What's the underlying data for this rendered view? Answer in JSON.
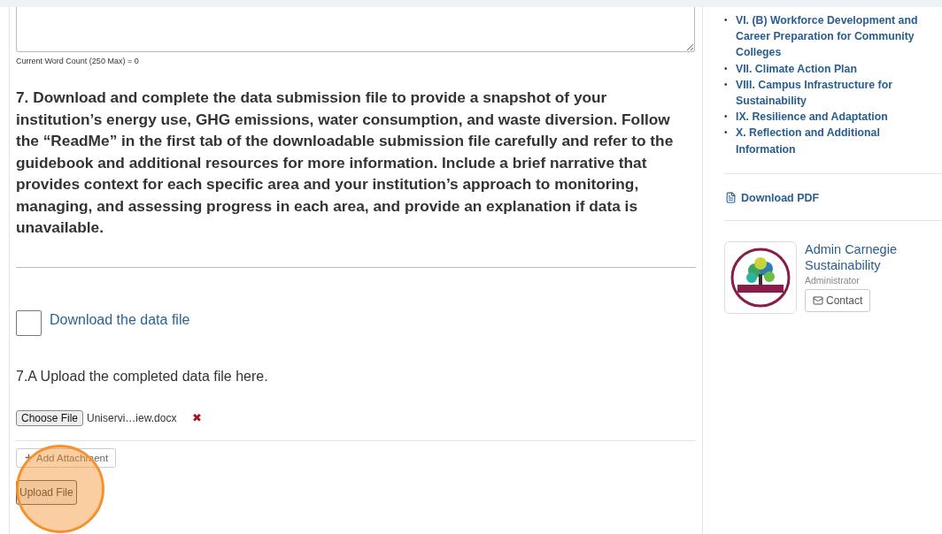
{
  "main": {
    "word_count": "Current Word Count (250 Max) = 0",
    "question": "7. Download and complete the data submission file to provide a snapshot of your institution’s energy use, GHG emissions, water consumption, and waste diversion. Follow the “ReadMe” in the first tab of the downloadable submission file carefully and refer to the guidebook and additional resources for more information. Include a brief narrative that provides context for each specific area and your institution’s approach to monitoring, managing, and assessing progress in each area, and provide an explanation if data is unavailable.",
    "download": {
      "label": "Download the data file",
      "checked": false
    },
    "upload_prompt": "7.A Upload the completed data file here.",
    "file_input": {
      "button": "Choose File",
      "filename": "Uniservi…iew.docx",
      "remove": "✖"
    },
    "add_attachment": "Add Attachment",
    "upload_button": "Upload File"
  },
  "sidebar": {
    "sections": [
      {
        "marker": "•",
        "label": "VI. (B) Workforce Development and Career Preparation for Community Colleges"
      },
      {
        "marker": "•",
        "label": "VII. Climate Action Plan"
      },
      {
        "marker": "•",
        "label": "VIII. Campus Infrastructure for Sustainability"
      },
      {
        "marker": "•",
        "label": "IX. Resilience and Adaptation"
      },
      {
        "marker": "•",
        "label": "X. Reflection and Additional Information"
      }
    ],
    "download_pdf": "Download PDF",
    "contact": {
      "name": "Admin Carnegie Sustainability",
      "role": "Administrator",
      "button": "Contact"
    }
  }
}
